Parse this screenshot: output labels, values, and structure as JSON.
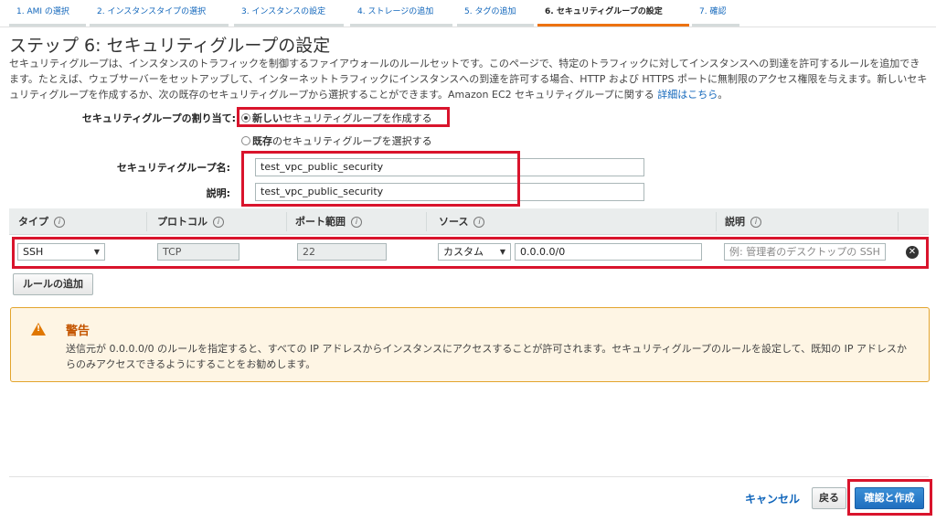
{
  "steps": [
    {
      "label": "1. AMI の選択",
      "active": false
    },
    {
      "label": "2. インスタンスタイプの選択",
      "active": false
    },
    {
      "label": "3. インスタンスの設定",
      "active": false
    },
    {
      "label": "4. ストレージの追加",
      "active": false
    },
    {
      "label": "5. タグの追加",
      "active": false
    },
    {
      "label": "6. セキュリティグループの設定",
      "active": true
    },
    {
      "label": "7. 確認",
      "active": false
    }
  ],
  "page": {
    "title": "ステップ 6: セキュリティグループの設定",
    "intro": "セキュリティグループは、インスタンスのトラフィックを制御するファイアウォールのルールセットです。このページで、特定のトラフィックに対してインスタンスへの到達を許可するルールを追加できます。たとえば、ウェブサーバーをセットアップして、インターネットトラフィックにインスタンスへの到達を許可する場合、HTTP および HTTPS ポートに無制限のアクセス権限を与えます。新しいセキュリティグループを作成するか、次の既存のセキュリティグループから選択することができます。Amazon EC2 セキュリティグループに関する ",
    "intro_link": "詳細はこちら",
    "intro_end": "。"
  },
  "assign": {
    "label": "セキュリティグループの割り当て:",
    "option_new_bold": "新しい",
    "option_new_rest": "セキュリティグループを作成する",
    "option_existing_bold": "既存",
    "option_existing_rest": "のセキュリティグループを選択する"
  },
  "form": {
    "name_label": "セキュリティグループ名:",
    "name_value": "test_vpc_public_security",
    "desc_label": "説明:",
    "desc_value": "test_vpc_public_security"
  },
  "table": {
    "headers": {
      "type": "タイプ",
      "protocol": "プロトコル",
      "port": "ポート範囲",
      "source": "ソース",
      "description": "説明"
    },
    "info_glyph": "i",
    "rows": [
      {
        "type": "SSH",
        "protocol": "TCP",
        "port": "22",
        "source_mode": "カスタム",
        "source_value": "0.0.0.0/0",
        "description_placeholder": "例: 管理者のデスクトップの SSH"
      }
    ]
  },
  "add_rule_label": "ルールの追加",
  "warning": {
    "title": "警告",
    "text": "送信元が 0.0.0.0/0 のルールを指定すると、すべての IP アドレスからインスタンスにアクセスすることが許可されます。セキュリティグループのルールを設定して、既知の IP アドレスからのみアクセスできるようにすることをお勧めします。",
    "icon_glyph": "!"
  },
  "footer": {
    "cancel": "キャンセル",
    "back": "戻る",
    "review_launch": "確認と作成"
  },
  "colors": {
    "link": "#1166bb",
    "highlight": "#d9142c",
    "active_tab": "#ec7211",
    "warning": "#e07700"
  },
  "icons": {
    "remove": "remove-circle-icon",
    "warning": "warning-triangle-icon",
    "info": "info-circle-icon"
  }
}
